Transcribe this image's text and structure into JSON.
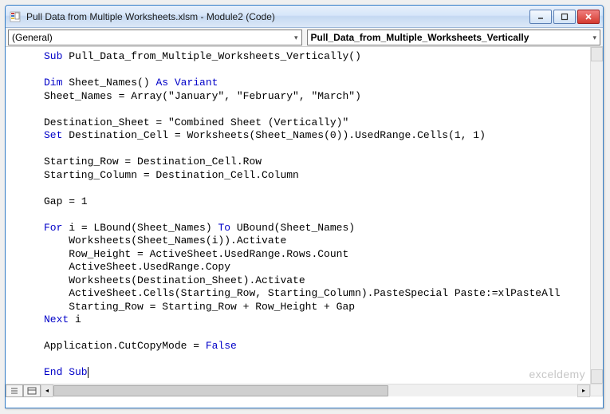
{
  "window": {
    "title": "Pull Data from Multiple Worksheets.xlsm - Module2 (Code)"
  },
  "dropdowns": {
    "object": "(General)",
    "procedure": "Pull_Data_from_Multiple_Worksheets_Vertically"
  },
  "code": {
    "lines": [
      {
        "t": "sub_decl",
        "pre": "Sub ",
        "name": "Pull_Data_from_Multiple_Worksheets_Vertically()"
      },
      {
        "t": "blank"
      },
      {
        "t": "dim",
        "pre": "Dim ",
        "mid": "Sheet_Names() ",
        "post": "As Variant"
      },
      {
        "t": "plain",
        "text": "Sheet_Names = Array(\"January\", \"February\", \"March\")"
      },
      {
        "t": "blank"
      },
      {
        "t": "plain",
        "text": "Destination_Sheet = \"Combined Sheet (Vertically)\""
      },
      {
        "t": "set",
        "pre": "Set ",
        "rest": "Destination_Cell = Worksheets(Sheet_Names(0)).UsedRange.Cells(1, 1)"
      },
      {
        "t": "blank"
      },
      {
        "t": "plain",
        "text": "Starting_Row = Destination_Cell.Row"
      },
      {
        "t": "plain",
        "text": "Starting_Column = Destination_Cell.Column"
      },
      {
        "t": "blank"
      },
      {
        "t": "plain",
        "text": "Gap = 1"
      },
      {
        "t": "blank"
      },
      {
        "t": "for",
        "pre": "For ",
        "mid1": "i = LBound(Sheet_Names) ",
        "to": "To ",
        "mid2": "UBound(Sheet_Names)"
      },
      {
        "t": "indent",
        "text": "Worksheets(Sheet_Names(i)).Activate"
      },
      {
        "t": "indent",
        "text": "Row_Height = ActiveSheet.UsedRange.Rows.Count"
      },
      {
        "t": "indent",
        "text": "ActiveSheet.UsedRange.Copy"
      },
      {
        "t": "indent",
        "text": "Worksheets(Destination_Sheet).Activate"
      },
      {
        "t": "indent",
        "text": "ActiveSheet.Cells(Starting_Row, Starting_Column).PasteSpecial Paste:=xlPasteAll"
      },
      {
        "t": "indent",
        "text": "Starting_Row = Starting_Row + Row_Height + Gap"
      },
      {
        "t": "next",
        "pre": "Next ",
        "rest": "i"
      },
      {
        "t": "blank"
      },
      {
        "t": "bool",
        "pre": "Application.CutCopyMode = ",
        "kw": "False"
      },
      {
        "t": "blank"
      },
      {
        "t": "end_sub",
        "text": "End Sub"
      }
    ]
  },
  "watermark": "exceldemy",
  "chart_data": null
}
